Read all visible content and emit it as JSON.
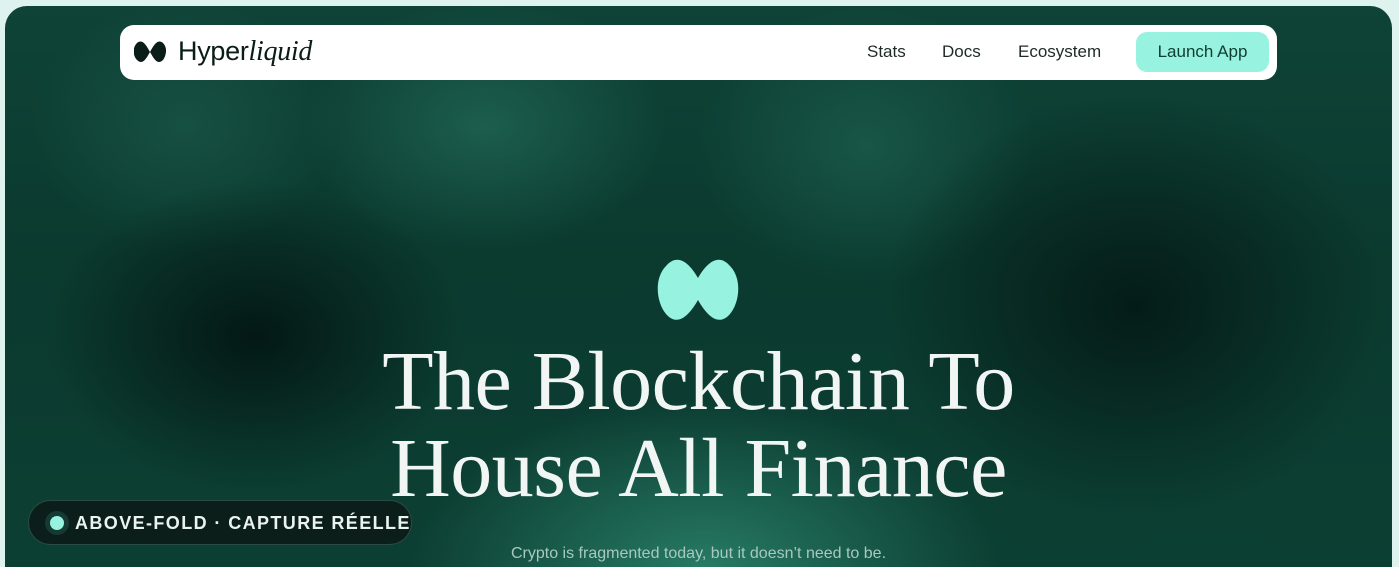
{
  "colors": {
    "accent": "#97f2df",
    "background_dark": "#0b3a2f",
    "navbar_bg": "#ffffff",
    "badge_bg": "#0c1e1a"
  },
  "navbar": {
    "brand_plain": "Hyper",
    "brand_italic": "liquid",
    "logo_icon": "hyperliquid-logo-icon",
    "links": [
      "Stats",
      "Docs",
      "Ecosystem"
    ],
    "cta_label": "Launch App"
  },
  "hero": {
    "mark_icon": "hyperliquid-blob-icon",
    "title_line1": "The Blockchain To",
    "title_line2": "House All Finance",
    "subtitle": "Crypto is fragmented today, but it doesn’t need to be."
  },
  "badge": {
    "label": "ABOVE-FOLD · CAPTURE RÉELLE"
  }
}
